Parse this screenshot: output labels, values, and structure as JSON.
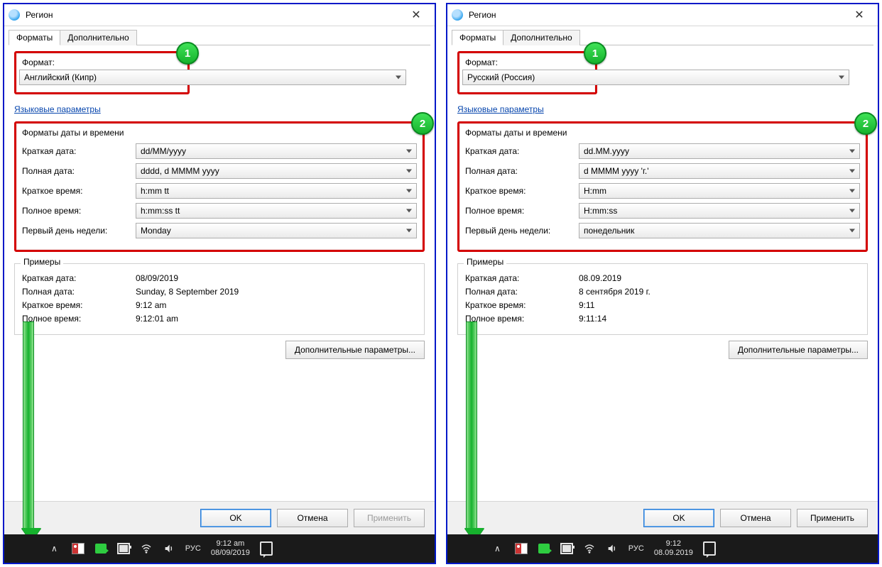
{
  "window_title": "Регион",
  "tabs": {
    "formats": "Форматы",
    "advanced": "Дополнительно"
  },
  "left": {
    "format_label": "Формат:",
    "format_value": "Английский (Кипр)",
    "lang_params_link": "Языковые параметры",
    "section_title": "Форматы даты и времени",
    "rows": {
      "short_date_label": "Краткая дата:",
      "short_date_value": "dd/MM/yyyy",
      "long_date_label": "Полная дата:",
      "long_date_value": "dddd, d MMMM yyyy",
      "short_time_label": "Краткое время:",
      "short_time_value": "h:mm tt",
      "long_time_label": "Полное время:",
      "long_time_value": "h:mm:ss tt",
      "first_day_label": "Первый день недели:",
      "first_day_value": "Monday"
    },
    "examples_title": "Примеры",
    "examples": {
      "short_date_label": "Краткая дата:",
      "short_date_value": "08/09/2019",
      "long_date_label": "Полная дата:",
      "long_date_value": "Sunday, 8 September 2019",
      "short_time_label": "Краткое время:",
      "short_time_value": "9:12 am",
      "long_time_label": "Полное время:",
      "long_time_value": "9:12:01 am"
    },
    "additional_params": "Дополнительные параметры...",
    "ok": "OK",
    "cancel": "Отмена",
    "apply": "Применить",
    "taskbar": {
      "lang": "РУС",
      "time": "9:12 am",
      "date": "08/09/2019"
    }
  },
  "right": {
    "format_label": "Формат:",
    "format_value": "Русский (Россия)",
    "lang_params_link": "Языковые параметры",
    "section_title": "Форматы даты и времени",
    "rows": {
      "short_date_label": "Краткая дата:",
      "short_date_value": "dd.MM.yyyy",
      "long_date_label": "Полная дата:",
      "long_date_value": "d MMMM yyyy 'г.'",
      "short_time_label": "Краткое время:",
      "short_time_value": "H:mm",
      "long_time_label": "Полное время:",
      "long_time_value": "H:mm:ss",
      "first_day_label": "Первый день недели:",
      "first_day_value": "понедельник"
    },
    "examples_title": "Примеры",
    "examples": {
      "short_date_label": "Краткая дата:",
      "short_date_value": "08.09.2019",
      "long_date_label": "Полная дата:",
      "long_date_value": "8 сентября 2019 г.",
      "short_time_label": "Краткое время:",
      "short_time_value": "9:11",
      "long_time_label": "Полное время:",
      "long_time_value": "9:11:14"
    },
    "additional_params": "Дополнительные параметры...",
    "ok": "OK",
    "cancel": "Отмена",
    "apply": "Применить",
    "taskbar": {
      "lang": "РУС",
      "time": "9:12",
      "date": "08.09.2019"
    }
  },
  "callouts": {
    "one": "1",
    "two": "2"
  }
}
